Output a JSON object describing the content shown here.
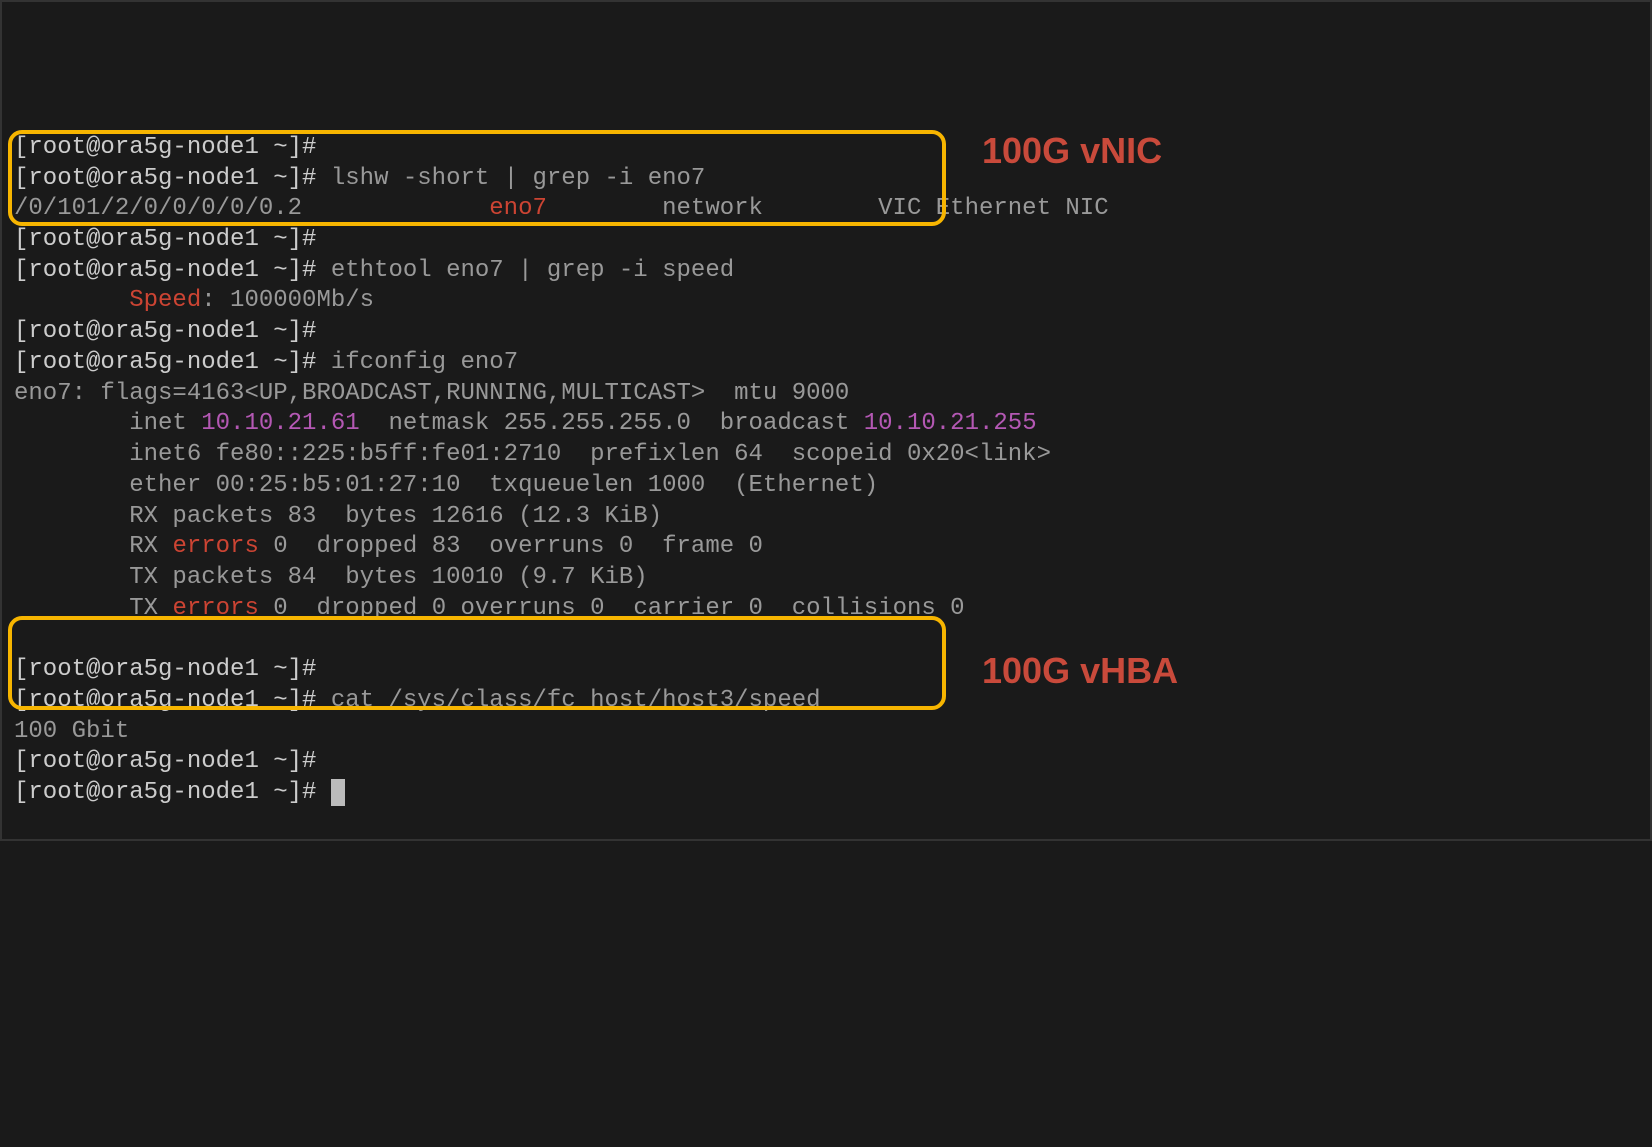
{
  "prompt": "[root@ora5g-node1 ~]#",
  "cmds": {
    "lshw": "lshw -short | grep -i eno7",
    "ethtool": "ethtool eno7 | grep -i speed",
    "ifconfig": "ifconfig eno7",
    "cat": "cat /sys/class/fc_host/host3/speed"
  },
  "lshw_out": {
    "path": "/0/101/2/0/0/0/0/0.2",
    "device": "eno7",
    "class": "network",
    "desc": "VIC Ethernet NIC"
  },
  "ethtool_out": {
    "label": "Speed",
    "value": ": 100000Mb/s"
  },
  "ifconfig_out": {
    "header": "eno7: flags=4163<UP,BROADCAST,RUNNING,MULTICAST>  mtu 9000",
    "inet_prefix": "        inet ",
    "inet_ip": "10.10.21.61",
    "inet_mid": "  netmask 255.255.255.0  broadcast ",
    "inet_bcast": "10.10.21.255",
    "inet6": "        inet6 fe80::225:b5ff:fe01:2710  prefixlen 64  scopeid 0x20<link>",
    "ether": "        ether 00:25:b5:01:27:10  txqueuelen 1000  (Ethernet)",
    "rxpackets": "        RX packets 83  bytes 12616 (12.3 KiB)",
    "rxerr_prefix": "        RX ",
    "errors_label": "errors",
    "rxerr_suffix": " 0  dropped 83  overruns 0  frame 0",
    "txpackets": "        TX packets 84  bytes 10010 (9.7 KiB)",
    "txerr_prefix": "        TX ",
    "txerr_suffix": " 0  dropped 0 overruns 0  carrier 0  collisions 0"
  },
  "cat_out": "100 Gbit",
  "annotations": {
    "vnic": "100G vNIC",
    "vhba": "100G vHBA"
  }
}
